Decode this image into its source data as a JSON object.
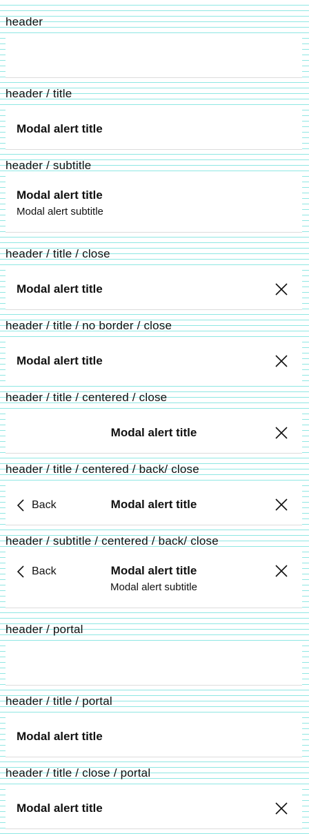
{
  "colors": {
    "grid_line": "#8ee7e3",
    "panel_bg": "#ffffff",
    "text": "#111111"
  },
  "icons": {
    "close": "close-icon",
    "back": "chevron-left-icon"
  },
  "sections": [
    {
      "label": "header"
    },
    {
      "label": "header / title",
      "title": "Modal alert title"
    },
    {
      "label": "header / subtitle",
      "title": "Modal alert title",
      "subtitle": "Modal alert subtitle"
    },
    {
      "label": "header / title / close",
      "title": "Modal alert title"
    },
    {
      "label": "header / title / no border / close",
      "title": "Modal alert title"
    },
    {
      "label": "header / title / centered / close",
      "title": "Modal alert title"
    },
    {
      "label": "header / title / centered / back/ close",
      "title": "Modal alert title",
      "back": "Back"
    },
    {
      "label": "header / subtitle / centered / back/ close",
      "title": "Modal alert title",
      "subtitle": "Modal alert subtitle",
      "back": "Back"
    },
    {
      "label": "header / portal"
    },
    {
      "label": "header / title / portal",
      "title": "Modal alert title"
    },
    {
      "label": "header / title / close / portal",
      "title": "Modal alert title"
    }
  ]
}
